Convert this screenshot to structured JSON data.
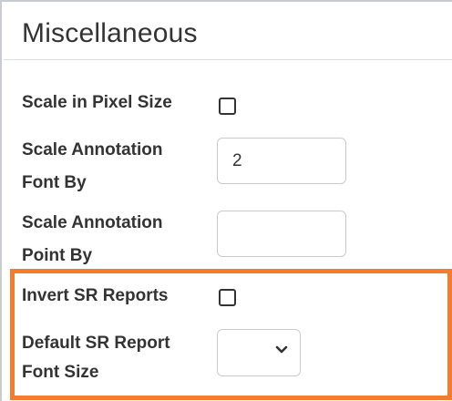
{
  "section": {
    "title": "Miscellaneous"
  },
  "fields": {
    "scale_pixel": {
      "label": "Scale in Pixel Size",
      "checked": false
    },
    "annotation_font": {
      "label_line1": "Scale Annotation",
      "label_line2": "Font By",
      "value": "2"
    },
    "annotation_point": {
      "label_line1": "Scale Annotation",
      "label_line2": "Point By",
      "value": ""
    },
    "invert_sr": {
      "label": "Invert SR Reports",
      "checked": false
    },
    "sr_font_size": {
      "label_line1": "Default SR Report",
      "label_line2": "Font Size",
      "selected": ""
    }
  },
  "colors": {
    "highlight": "#f47c2c",
    "text": "#333333",
    "border": "#c8ccd1"
  }
}
